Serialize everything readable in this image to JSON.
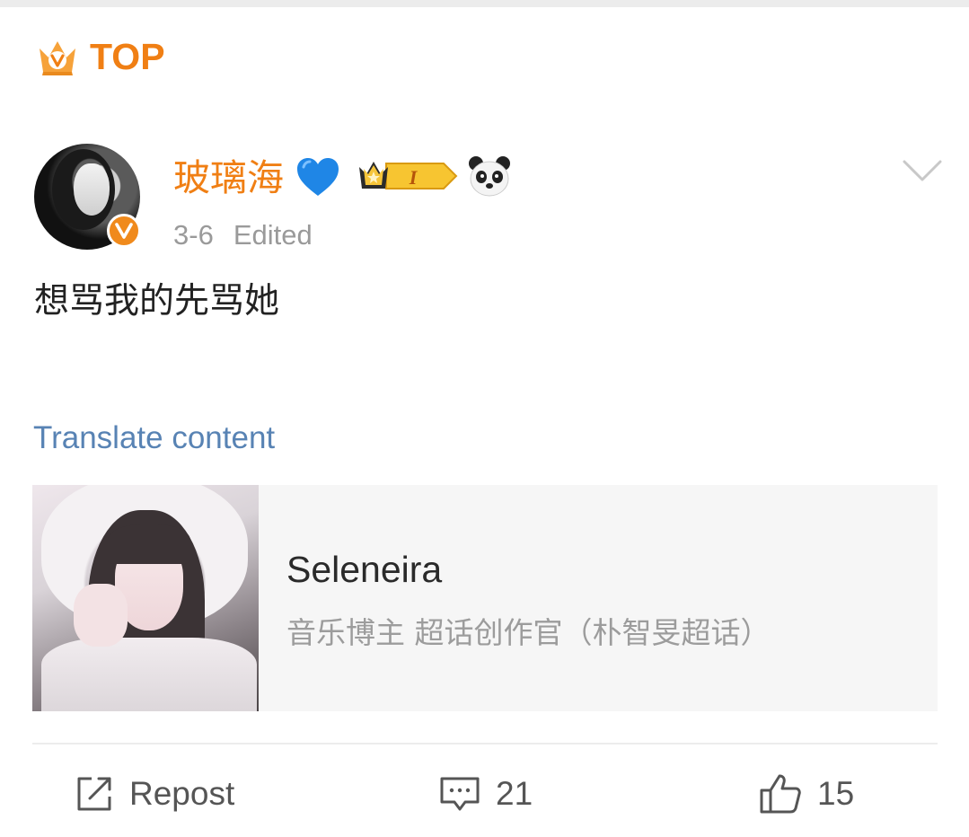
{
  "badge": {
    "label": "TOP",
    "icon": "crown-v-icon"
  },
  "author": {
    "name": "玻璃海",
    "emoji": "💙",
    "verified_icon": "verified-v-icon",
    "rank_badge": "I",
    "extra_icon": "panda-icon"
  },
  "post": {
    "date": "3-6",
    "edited": "Edited",
    "text": "想骂我的先骂她",
    "translate": "Translate content"
  },
  "card": {
    "title": "Seleneira",
    "subtitle": "音乐博主 超话创作官（朴智旻超话）"
  },
  "actions": {
    "repost_label": "Repost",
    "comment_count": "21",
    "like_count": "15"
  },
  "colors": {
    "accent": "#f07f14",
    "link": "#5883b4",
    "muted": "#9a9a9a"
  }
}
